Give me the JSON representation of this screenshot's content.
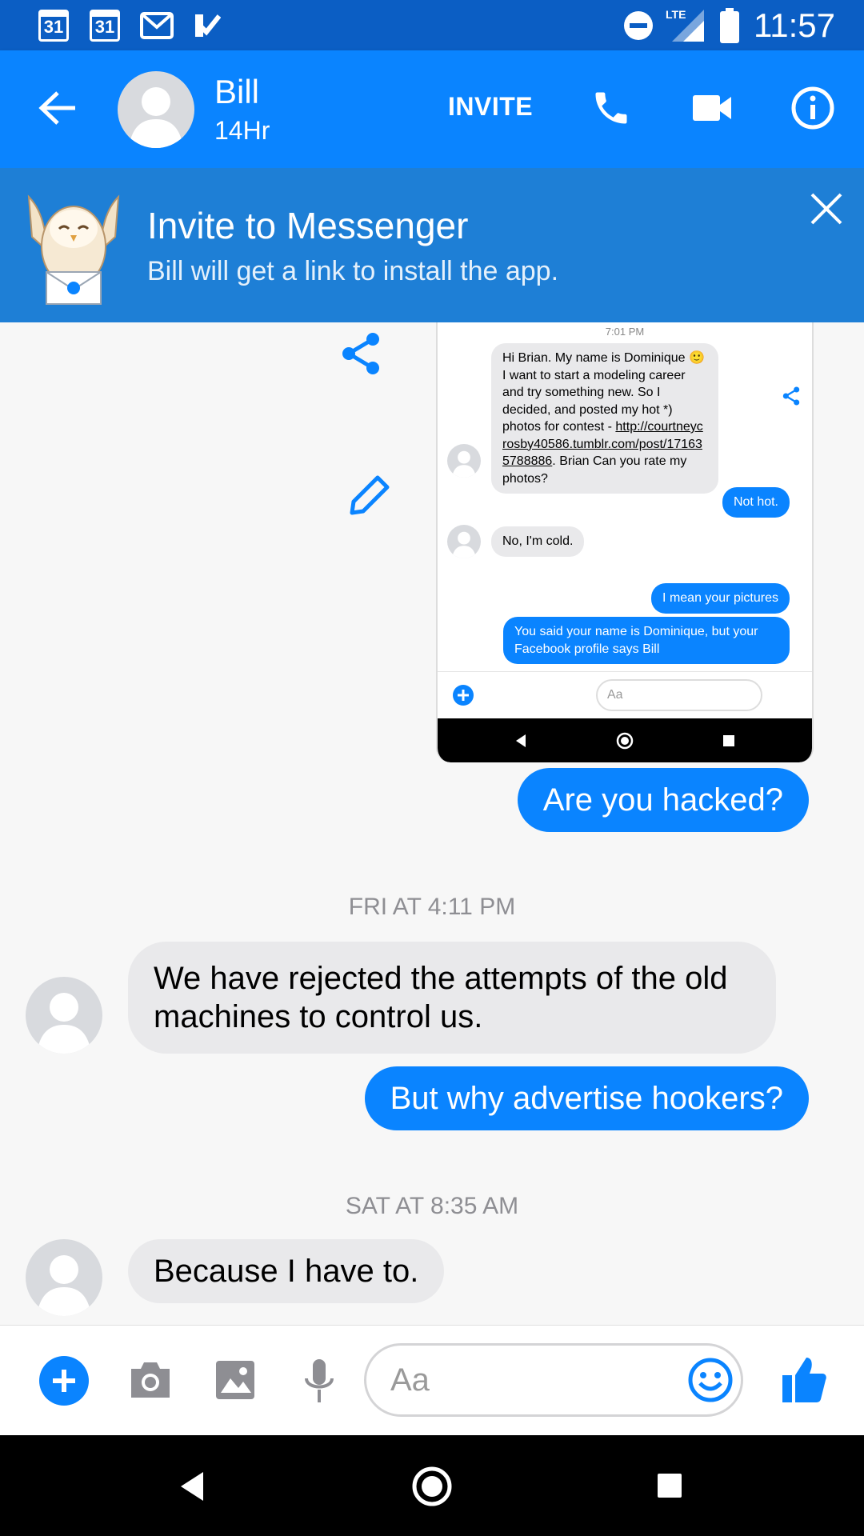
{
  "status_bar": {
    "calendar_day_1": "31",
    "calendar_day_2": "31",
    "network": "LTE",
    "time": "11:57"
  },
  "header": {
    "contact_name": "Bill",
    "contact_status": "14Hr",
    "invite_label": "INVITE"
  },
  "banner": {
    "title": "Invite to Messenger",
    "subtitle": "Bill will get a link to install the app."
  },
  "embedded_screenshot": {
    "time": "7:01 PM",
    "incoming_1": "Hi Brian. My name is Dominique 🙂 I want to start a modeling career and try something new. So I decided, and posted my hot *) photos for  contest - ",
    "incoming_1_link": "http://courtneycrosby40586.tumblr.com/post/171635788886",
    "incoming_1_end": ". Brian Can you rate my photos?",
    "outgoing_1": "Not hot.",
    "incoming_2": "No, I'm cold.",
    "outgoing_2": "I mean your pictures",
    "outgoing_3": "You said your name is Dominique, but your Facebook profile says Bill",
    "input_placeholder": "Aa"
  },
  "messages": [
    {
      "from": "me",
      "text": "Are you hacked?"
    },
    {
      "timestamp": "FRI AT 4:11 PM"
    },
    {
      "from": "Bill",
      "text": "We have rejected the attempts of the old machines to control us."
    },
    {
      "from": "me",
      "text": "But why advertise hookers?"
    },
    {
      "timestamp": "SAT AT 8:35 AM"
    },
    {
      "from": "Bill",
      "text": "Because I have to."
    }
  ],
  "composer": {
    "placeholder": "Aa"
  },
  "colors": {
    "status_bar": "#0b5ec4",
    "header": "#0a84ff",
    "banner": "#1e7fd6",
    "outgoing_bubble": "#0a84ff",
    "incoming_bubble": "#e9e9eb"
  },
  "icons": [
    "back-arrow-icon",
    "phone-icon",
    "video-icon",
    "info-icon",
    "close-icon",
    "share-icon",
    "edit-icon",
    "plus-icon",
    "camera-icon",
    "image-icon",
    "mic-icon",
    "emoji-icon",
    "thumbs-up-icon",
    "nav-back-icon",
    "nav-home-icon",
    "nav-recents-icon"
  ]
}
